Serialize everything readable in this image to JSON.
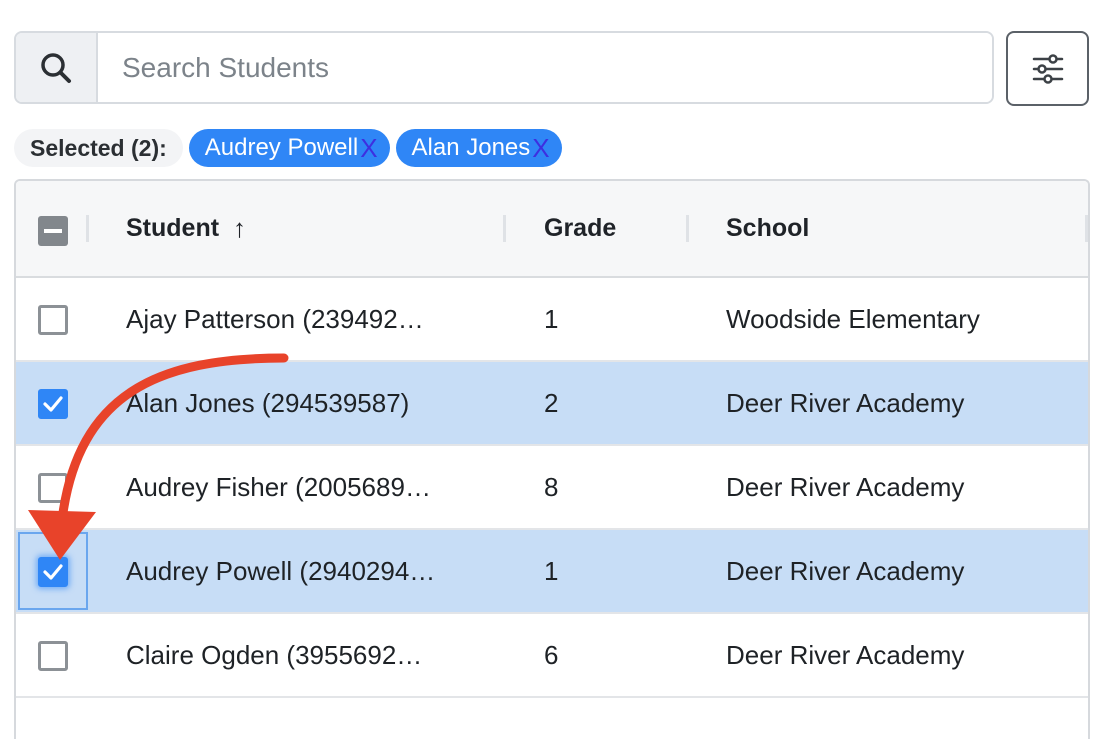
{
  "search": {
    "placeholder": "Search Students",
    "value": ""
  },
  "selected": {
    "label": "Selected (2):",
    "chips": [
      {
        "label": "Audrey Powell",
        "remove": "X"
      },
      {
        "label": "Alan Jones",
        "remove": "X"
      }
    ]
  },
  "table": {
    "columns": {
      "student": "Student",
      "sort_icon": "↑",
      "grade": "Grade",
      "school": "School"
    },
    "rows": [
      {
        "student": "Ajay Patterson (239492…",
        "grade": "1",
        "school": "Woodside Elementary",
        "checked": false
      },
      {
        "student": "Alan Jones (294539587)",
        "grade": "2",
        "school": "Deer River Academy",
        "checked": true
      },
      {
        "student": "Audrey Fisher (2005689…",
        "grade": "8",
        "school": "Deer River Academy",
        "checked": false
      },
      {
        "student": "Audrey Powell (2940294…",
        "grade": "1",
        "school": "Deer River Academy",
        "checked": true
      },
      {
        "student": "Claire Ogden (3955692…",
        "grade": "6",
        "school": "Deer River Academy",
        "checked": false
      }
    ]
  },
  "icons": {
    "search": "search-icon",
    "filter": "sliders-icon",
    "header_checkbox": "indeterminate-checkbox-icon",
    "check": "checkmark-icon",
    "annotation": "curved-arrow-icon"
  },
  "colors": {
    "accent": "#2f86f6",
    "selected_row": "#c7ddf6",
    "annotation_arrow": "#e8432a"
  }
}
